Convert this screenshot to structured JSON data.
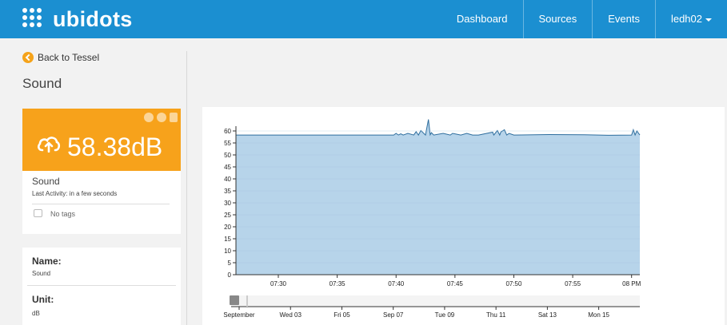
{
  "header": {
    "brand": "ubidots",
    "nav": [
      {
        "label": "Dashboard"
      },
      {
        "label": "Sources"
      },
      {
        "label": "Events"
      },
      {
        "label": "ledh02"
      }
    ]
  },
  "back_link": "Back to Tessel",
  "page_title": "Sound",
  "variable_card": {
    "value": "58.38dB",
    "name": "Sound",
    "last_activity": "Last Activity: in a few seconds",
    "tags": "No tags",
    "color": "#f7a21b"
  },
  "info_card": {
    "name_label": "Name:",
    "name_value": "Sound",
    "unit_label": "Unit:",
    "unit_value": "dB"
  },
  "chart_data": {
    "type": "area",
    "fill_color": "#b7d4ea",
    "line_color": "#2e6e9e",
    "y_ticks": [
      "0",
      "5",
      "10",
      "15",
      "20",
      "25",
      "30",
      "35",
      "40",
      "45",
      "50",
      "55",
      "60"
    ],
    "ylim": [
      0,
      62
    ],
    "x_ticks": [
      "07:30",
      "07:35",
      "07:40",
      "07:45",
      "07:50",
      "07:55",
      "08 PM"
    ],
    "x_tick_minutes": [
      30,
      35,
      40,
      45,
      50,
      55,
      60
    ],
    "xlim_minutes": [
      26.4,
      60.7
    ],
    "series": {
      "x_minutes": [
        26.4,
        33.0,
        39.8,
        40.0,
        40.2,
        40.4,
        40.6,
        41.0,
        41.5,
        41.7,
        41.9,
        42.1,
        42.5,
        42.6,
        42.75,
        42.9,
        43.0,
        43.2,
        44.0,
        44.6,
        44.8,
        45.5,
        46.0,
        46.5,
        47.0,
        48.2,
        48.3,
        48.6,
        48.8,
        48.9,
        49.2,
        49.4,
        49.6,
        50.0,
        53.0,
        56.0,
        58.0,
        60.0,
        60.15,
        60.3,
        60.45,
        60.7
      ],
      "values": [
        58.3,
        58.3,
        58.3,
        59.0,
        58.3,
        58.8,
        58.3,
        59.0,
        58.3,
        59.7,
        58.3,
        60.2,
        58.3,
        61.0,
        64.8,
        58.4,
        59.3,
        58.3,
        59.0,
        58.3,
        59.0,
        58.3,
        59.0,
        58.3,
        58.3,
        59.5,
        58.3,
        60.2,
        58.3,
        59.6,
        60.5,
        58.3,
        59.0,
        58.3,
        58.5,
        58.4,
        58.2,
        58.3,
        60.5,
        58.3,
        60.0,
        58.3
      ]
    },
    "navigator": {
      "labels": [
        "September",
        "Wed 03",
        "Fri 05",
        "Sep 07",
        "Tue 09",
        "Thu 11",
        "Sat 13",
        "Mon 15"
      ]
    }
  }
}
